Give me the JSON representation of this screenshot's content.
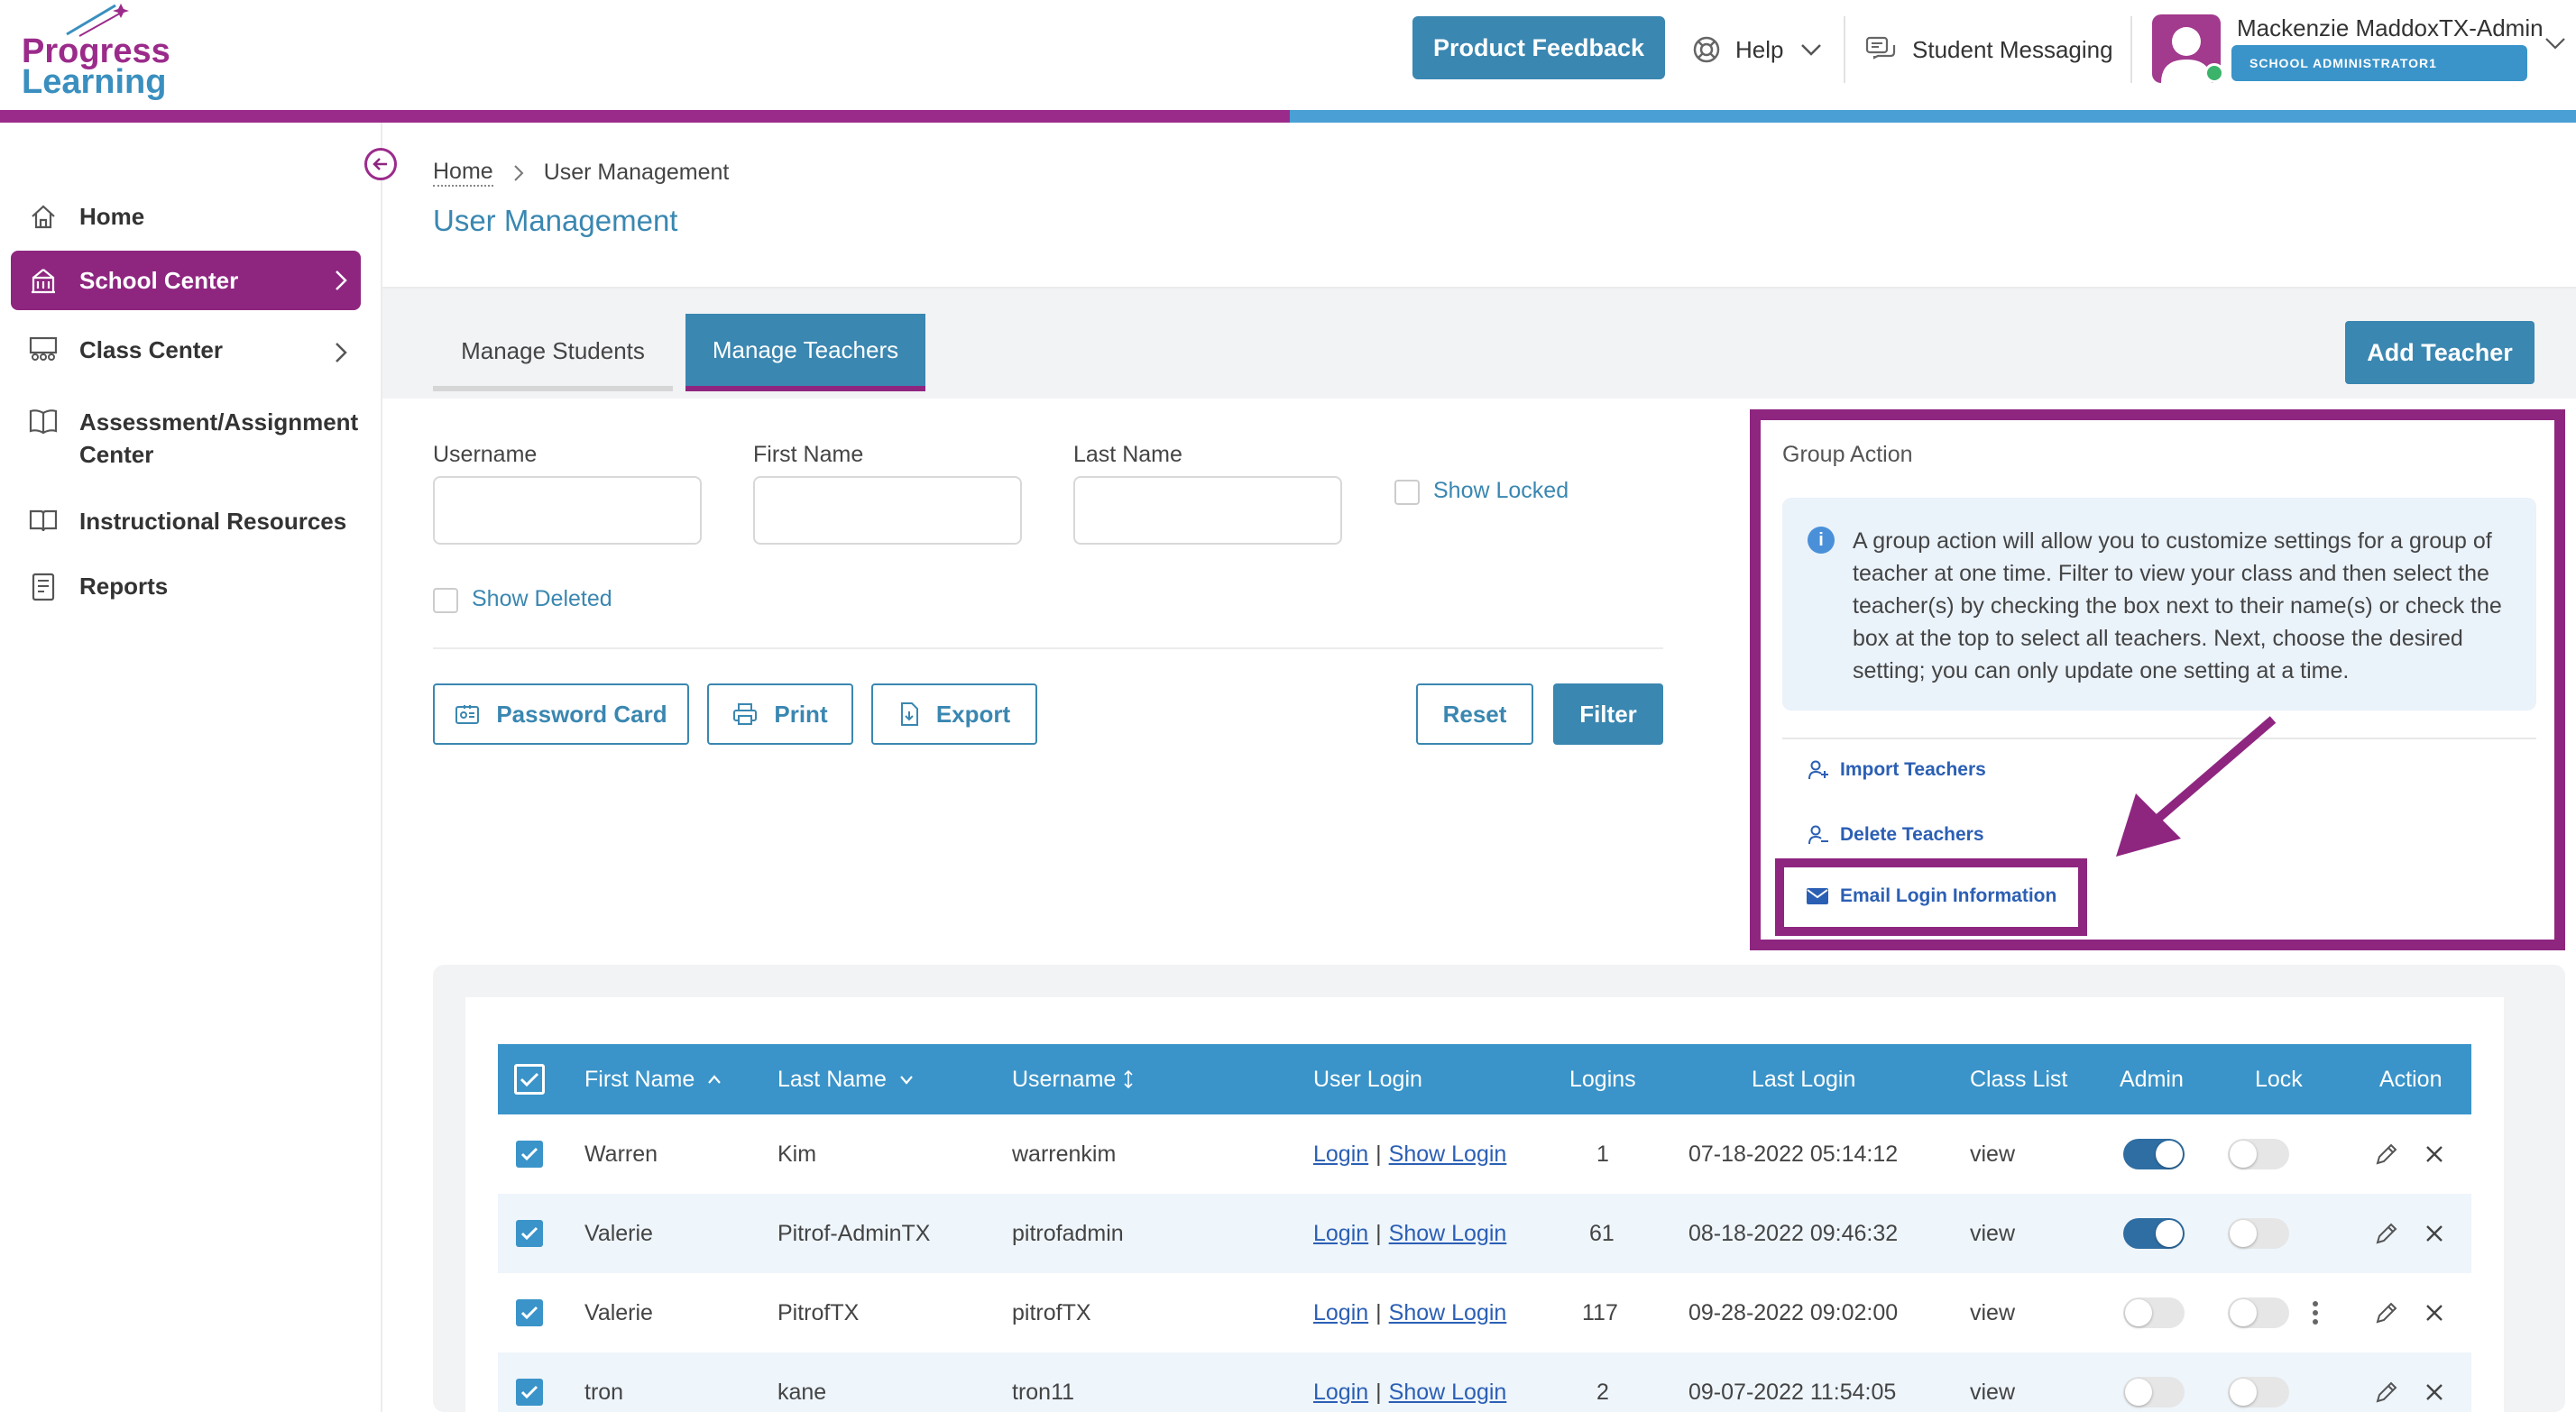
{
  "header": {
    "logo": [
      "Progress",
      "Learning"
    ],
    "feedback_button": "Product Feedback",
    "help_label": "Help",
    "messaging_label": "Student Messaging",
    "user_name": "Mackenzie MaddoxTX-Admin",
    "user_role": "SCHOOL ADMINISTRATOR1"
  },
  "sidebar": {
    "items": [
      {
        "label": "Home",
        "icon": "home-icon"
      },
      {
        "label": "School Center",
        "icon": "school-icon"
      },
      {
        "label": "Class Center",
        "icon": "class-icon"
      },
      {
        "label": "Assessment/Assignment",
        "label2": "Center",
        "icon": "book-open-icon"
      },
      {
        "label": "Instructional Resources",
        "icon": "book-icon"
      },
      {
        "label": "Reports",
        "icon": "report-icon"
      }
    ]
  },
  "breadcrumb": {
    "home": "Home",
    "current": "User Management"
  },
  "page_title": "User Management",
  "tabs": {
    "students": "Manage Students",
    "teachers": "Manage Teachers"
  },
  "add_teacher": "Add Teacher",
  "filters": {
    "username_label": "Username",
    "first_name_label": "First Name",
    "last_name_label": "Last Name",
    "show_locked": "Show Locked",
    "show_deleted": "Show Deleted"
  },
  "buttons": {
    "password_card": "Password Card",
    "print": "Print",
    "export": "Export",
    "reset": "Reset",
    "filter": "Filter"
  },
  "group_action": {
    "title": "Group Action",
    "info": "A group action will allow you to customize settings for a group of teacher at one time. Filter to view your class and then select the teacher(s) by checking the box next to their name(s) or check the box at the top to select all teachers. Next, choose the desired setting; you can only update one setting at a time.",
    "import": "Import Teachers",
    "delete": "Delete Teachers",
    "email": "Email Login Information"
  },
  "table": {
    "headers": {
      "first_name": "First Name",
      "last_name": "Last Name",
      "username": "Username",
      "user_login": "User Login",
      "logins": "Logins",
      "last_login": "Last Login",
      "class_list": "Class List",
      "admin": "Admin",
      "lock": "Lock",
      "action": "Action"
    },
    "login_link": "Login",
    "show_login_link": "Show Login",
    "view_link": "view",
    "rows": [
      {
        "first": "Warren",
        "last": "Kim",
        "username": "warrenkim",
        "logins": "1",
        "last_login": "07-18-2022 05:14:12",
        "admin": true,
        "lock": false
      },
      {
        "first": "Valerie",
        "last": "Pitrof-AdminTX",
        "username": "pitrofadmin",
        "logins": "61",
        "last_login": "08-18-2022 09:46:32",
        "admin": true,
        "lock": false
      },
      {
        "first": "Valerie",
        "last": "PitrofTX",
        "username": "pitrofTX",
        "logins": "117",
        "last_login": "09-28-2022 09:02:00",
        "admin": false,
        "lock": false
      },
      {
        "first": "tron",
        "last": "kane",
        "username": "tron11",
        "logins": "2",
        "last_login": "09-07-2022 11:54:05",
        "admin": false,
        "lock": false
      }
    ]
  },
  "colors": {
    "brand_purple": "#8e2680",
    "brand_blue": "#3a87b1",
    "header_blue": "#3a94c9"
  }
}
